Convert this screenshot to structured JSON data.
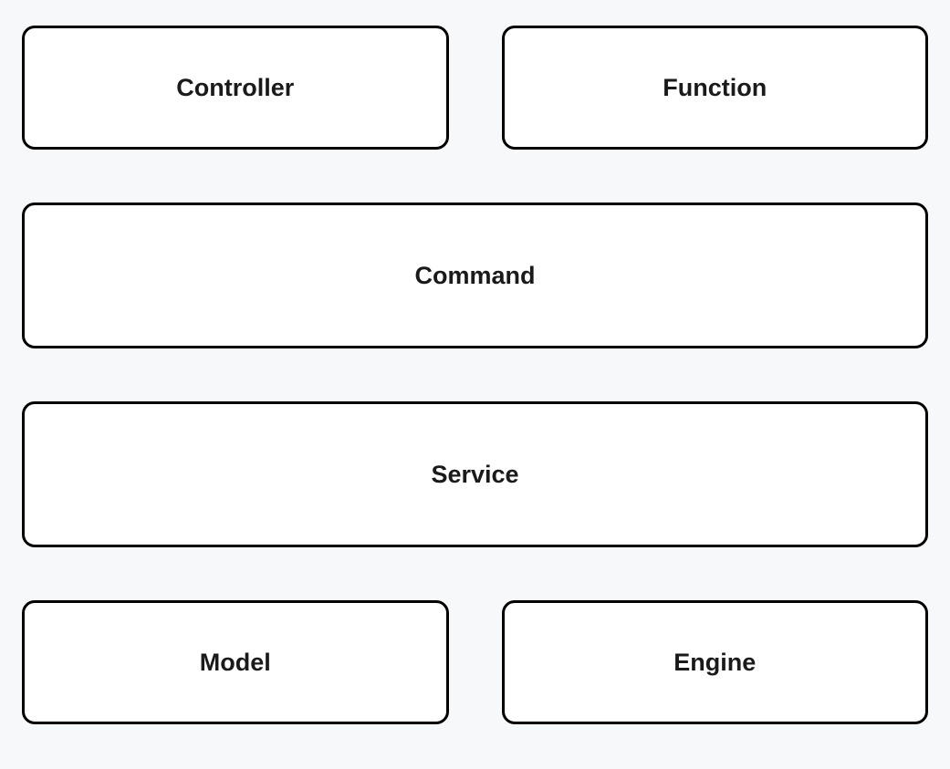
{
  "boxes": {
    "controller": "Controller",
    "function": "Function",
    "command": "Command",
    "service": "Service",
    "model": "Model",
    "engine": "Engine"
  }
}
